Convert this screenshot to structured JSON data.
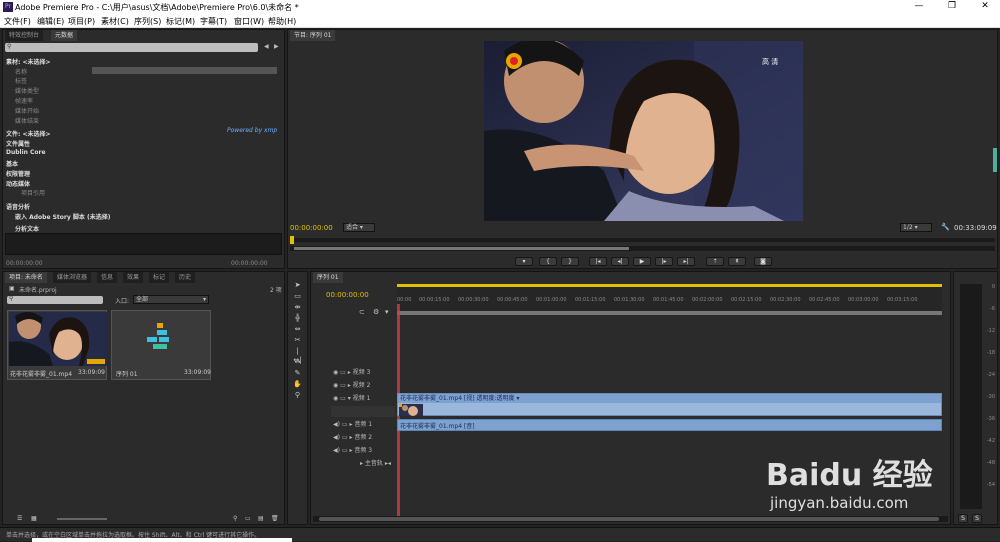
{
  "window": {
    "title": "Adobe Premiere Pro - C:\\用户\\asus\\文档\\Adobe\\Premiere Pro\\6.0\\未命名 *",
    "logo_text": "Pr"
  },
  "menu": [
    "文件(F)",
    "编辑(E)",
    "项目(P)",
    "素材(C)",
    "序列(S)",
    "标记(M)",
    "字幕(T)",
    "窗口(W)",
    "帮助(H)"
  ],
  "metadata_panel": {
    "tabs": [
      "特效控制台",
      "元数据"
    ],
    "material_header": "素材: <未选择>",
    "material_rows": [
      "名称",
      "标签",
      "媒体类型",
      "帧速率",
      "媒体开始",
      "媒体结束"
    ],
    "file_header": "文件: <未选择>",
    "powered_by": "Powered by xmp",
    "file_sections": [
      "文件属性",
      "Dublin Core",
      "基本",
      "权限管理",
      "动态媒体",
      "项目引用"
    ],
    "speech_header": "语音分析",
    "embed_story": "嵌入 Adobe Story 脚本 (未选择)",
    "analysis_text": "分析文本",
    "time_left": "00:00:00:00",
    "time_right": "00:00:00:00"
  },
  "program_monitor": {
    "tab": "节目: 序列 01",
    "watermark": "高 清",
    "timecode": "00:00:00:00",
    "fit": "适合",
    "scale": "1/2",
    "duration": "00:33:09:09"
  },
  "project_panel": {
    "tabs": [
      "项目: 未命名",
      "媒体浏览器",
      "信息",
      "效果",
      "标记",
      "历史"
    ],
    "item_count": "2 项",
    "file_name": "未命名.prproj",
    "in_label": "入口:",
    "in_value": "全部",
    "items": [
      {
        "name": "花非花雾非雾_01.mp4",
        "duration": "33:09:09"
      },
      {
        "name": "序列 01",
        "duration": "33:09:09"
      }
    ]
  },
  "timeline": {
    "tab": "序列 01",
    "timecode": "00:00:00:00",
    "ruler": [
      "00:00",
      "00:00:15:00",
      "00:00:30:00",
      "00:00:45:00",
      "00:01:00:00",
      "00:01:15:00",
      "00:01:30:00",
      "00:01:45:00",
      "00:02:00:00",
      "00:02:15:00",
      "00:02:30:00",
      "00:02:45:00",
      "00:03:00:00",
      "00:03:15:00"
    ],
    "video_tracks": [
      "视频 3",
      "视频 2",
      "视频 1"
    ],
    "audio_tracks": [
      "音频 1",
      "音频 2",
      "音频 3"
    ],
    "master": "主音轨",
    "video_clip": "花非花雾非雾_01.mp4 [视] 透明度:透明度 ▾",
    "audio_clip": "花非花雾非雾_01.mp4 [音]"
  },
  "meter_labels": [
    "0",
    "-6",
    "-12",
    "-18",
    "-24",
    "-30",
    "-36",
    "-42",
    "-48",
    "-54"
  ],
  "statusbar": "单击并选择，或在空白区域单击并拖拉为选取框。按住 Shift、Alt、和 Ctrl 键可进行其它操作。",
  "watermark_site": "Baidu 经验",
  "watermark_url": "jingyan.baidu.com"
}
